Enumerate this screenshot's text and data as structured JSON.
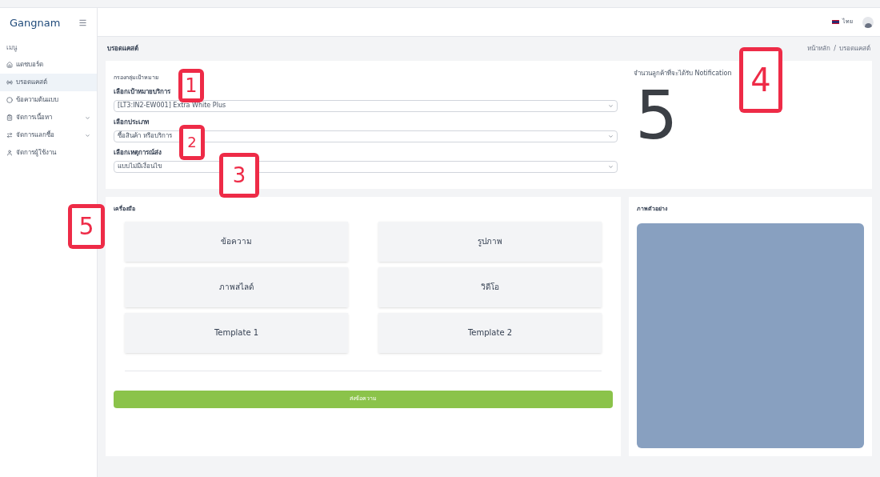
{
  "logo": {
    "text": "Gangnam"
  },
  "sidebar": {
    "heading": "เมนู",
    "items": [
      {
        "label": "แดชบอร์ด",
        "selected": false,
        "expandable": false
      },
      {
        "label": "บรอดแคสต์",
        "selected": true,
        "expandable": false
      },
      {
        "label": "ข้อความต้นแบบ",
        "selected": false,
        "expandable": false
      },
      {
        "label": "จัดการเนื้อหา",
        "selected": false,
        "expandable": true
      },
      {
        "label": "จัดการแลกซื้อ",
        "selected": false,
        "expandable": true
      },
      {
        "label": "จัดการผู้ใช้งาน",
        "selected": false,
        "expandable": false
      }
    ]
  },
  "topbar": {
    "language": "ไทย"
  },
  "page": {
    "title": "บรอดแคสต์",
    "breadcrumb": [
      "หน้าหลัก",
      "บรอดแคสต์"
    ],
    "separator": "/"
  },
  "filter": {
    "heading": "กรองกลุ่มเป้าหมาย",
    "fields": [
      {
        "label": "เลือกเป้าหมายบริการ",
        "value": "[LT3:IN2-EW001] Extra White Plus"
      },
      {
        "label": "เลือกประเภท",
        "value": "ซื้อสินค้า หรือบริการ"
      },
      {
        "label": "เลือกเหตุการณ์ส่ง",
        "value": "แบบไม่มีเงื่อนไข"
      }
    ]
  },
  "notification": {
    "label": "จำนวนลูกค้าที่จะได้รับ Notification",
    "count": "5"
  },
  "tools": {
    "title": "เครื่องมือ",
    "buttons": [
      "ข้อความ",
      "รูปภาพ",
      "ภาพสไลด์",
      "วิดีโอ",
      "Template 1",
      "Template 2"
    ],
    "send": "ส่งข้อความ"
  },
  "preview": {
    "title": "ภาพตัวอย่าง"
  },
  "callouts": [
    "1",
    "2",
    "3",
    "4",
    "5"
  ]
}
